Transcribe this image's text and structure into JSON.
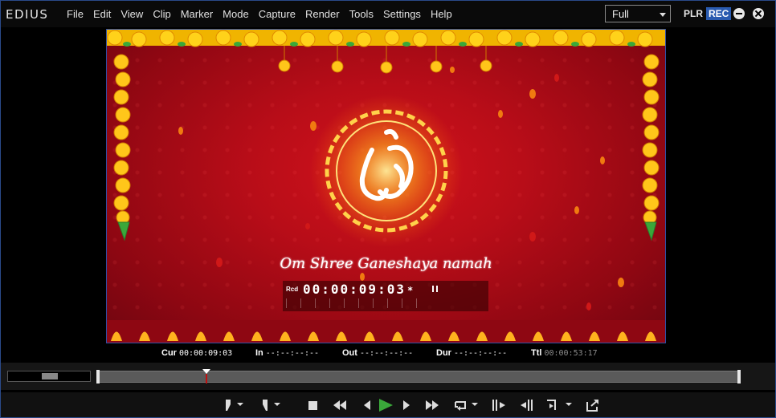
{
  "app": {
    "logo": "EDIUS",
    "menu": [
      "File",
      "Edit",
      "View",
      "Clip",
      "Marker",
      "Mode",
      "Capture",
      "Render",
      "Tools",
      "Settings",
      "Help"
    ],
    "zoom_select": {
      "value": "Full"
    },
    "plr_label": "PLR",
    "rec_label": "REC"
  },
  "preview": {
    "caption": "Om Shree Ganeshaya namah",
    "timecode_label": "Rcd",
    "timecode": "00:00:09:03",
    "timecode_marker": "*"
  },
  "info": {
    "cur_label": "Cur",
    "cur_value": "00:00:09:03",
    "in_label": "In",
    "in_value": "--:--:--:--",
    "out_label": "Out",
    "out_value": "--:--:--:--",
    "dur_label": "Dur",
    "dur_value": "--:--:--:--",
    "ttl_label": "Ttl",
    "ttl_value": "00:00:53:17"
  },
  "timeline": {
    "playhead_fraction": 0.17
  },
  "transport": {
    "buttons": [
      "set-in-icon",
      "set-out-icon",
      "stop-icon",
      "rewind-icon",
      "step-back-icon",
      "play-icon",
      "step-forward-icon",
      "fast-forward-icon",
      "loop-icon",
      "insert-to-timeline-icon",
      "overwrite-to-timeline-icon",
      "three-point-edit-icon",
      "export-icon"
    ]
  },
  "colors": {
    "accent_rec": "#2a5bb0",
    "play_green": "#3aa83a",
    "preview_red": "#b80d18",
    "playhead_red": "#c01010"
  }
}
